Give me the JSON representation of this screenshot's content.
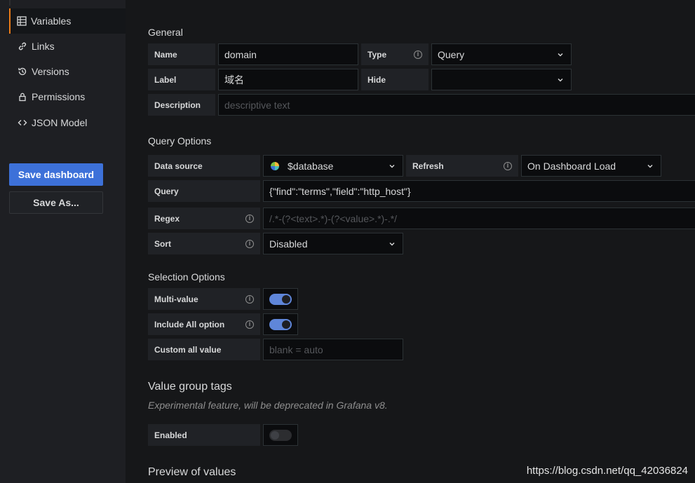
{
  "sidebar": {
    "items": [
      {
        "label": "Variables",
        "icon": "variables-icon",
        "active": true
      },
      {
        "label": "Links",
        "icon": "link-icon"
      },
      {
        "label": "Versions",
        "icon": "history-icon"
      },
      {
        "label": "Permissions",
        "icon": "lock-icon"
      },
      {
        "label": "JSON Model",
        "icon": "code-icon"
      }
    ],
    "save_label": "Save dashboard",
    "save_as_label": "Save As..."
  },
  "general": {
    "title": "General",
    "name_label": "Name",
    "name_value": "domain",
    "type_label": "Type",
    "type_value": "Query",
    "label_label": "Label",
    "label_value": "域名",
    "hide_label": "Hide",
    "hide_value": "",
    "description_label": "Description",
    "description_placeholder": "descriptive text"
  },
  "query_options": {
    "title": "Query Options",
    "datasource_label": "Data source",
    "datasource_value": "$database",
    "refresh_label": "Refresh",
    "refresh_value": "On Dashboard Load",
    "query_label": "Query",
    "query_value": "{\"find\":\"terms\",\"field\":\"http_host\"}",
    "regex_label": "Regex",
    "regex_placeholder": "/.*-(?<text>.*)-(?<value>.*)-.*/",
    "sort_label": "Sort",
    "sort_value": "Disabled"
  },
  "selection_options": {
    "title": "Selection Options",
    "multi_label": "Multi-value",
    "multi_on": true,
    "include_all_label": "Include All option",
    "include_all_on": true,
    "custom_all_label": "Custom all value",
    "custom_all_placeholder": "blank = auto"
  },
  "value_group_tags": {
    "title": "Value group tags",
    "note": "Experimental feature, will be deprecated in Grafana v8.",
    "enabled_label": "Enabled",
    "enabled_on": false
  },
  "preview": {
    "title": "Preview of values"
  },
  "info_glyph": "i",
  "watermark": "https://blog.csdn.net/qq_42036824",
  "colors": {
    "accent": "#eb7b18",
    "primary": "#3d71d9",
    "switch_on": "#5f86d9"
  }
}
